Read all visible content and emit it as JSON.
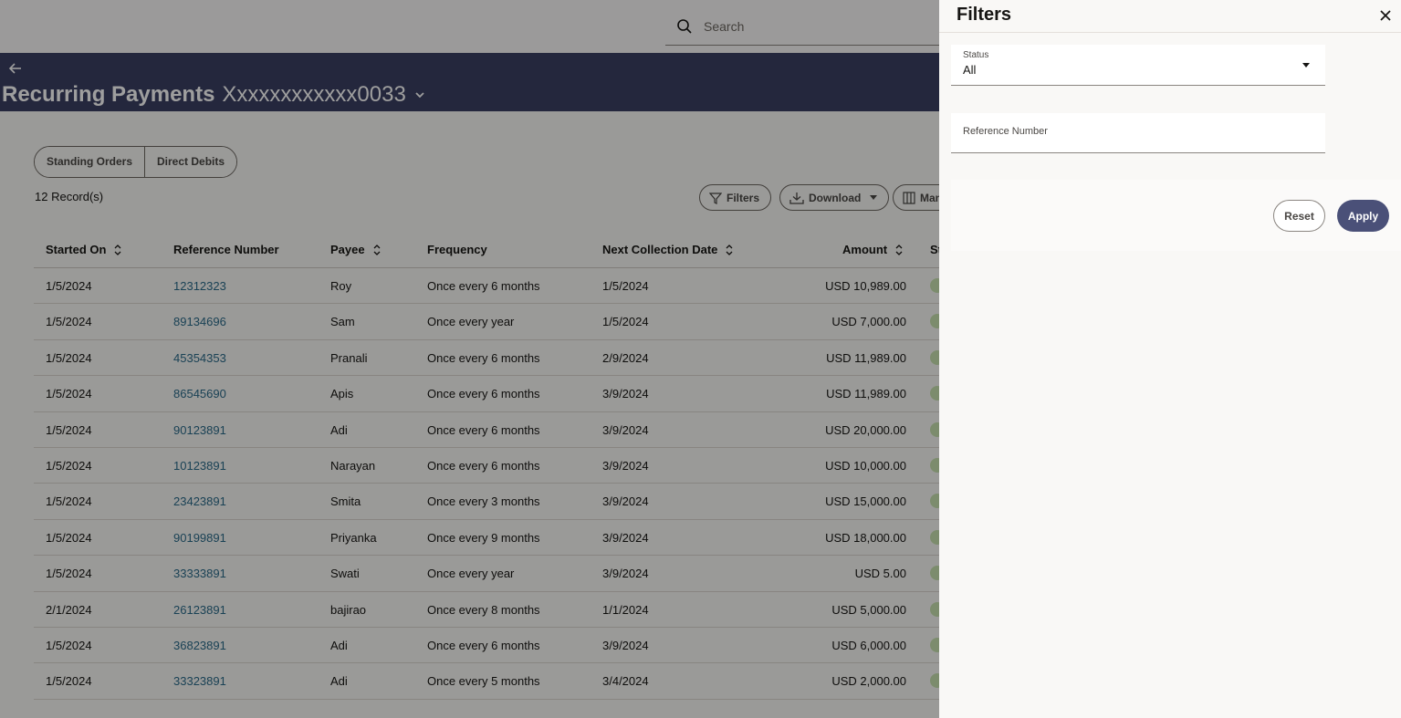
{
  "search": {
    "placeholder": "Search"
  },
  "hero": {
    "title": "Recurring Payments",
    "account": "Xxxxxxxxxxxx0033"
  },
  "tabs": [
    "Standing Orders",
    "Direct Debits"
  ],
  "records_label": "12 Record(s)",
  "toolbar": {
    "filters_label": "Filters",
    "download_label": "Download",
    "manage_label": "Man"
  },
  "table": {
    "headers": {
      "started_on": "Started On",
      "reference": "Reference Number",
      "payee": "Payee",
      "frequency": "Frequency",
      "next_collection": "Next Collection Date",
      "amount": "Amount",
      "status": "St"
    },
    "rows": [
      {
        "started_on": "1/5/2024",
        "reference": "12312323",
        "payee": "Roy",
        "frequency": "Once every 6 months",
        "next": "1/5/2024",
        "amount": "USD 10,989.00"
      },
      {
        "started_on": "1/5/2024",
        "reference": "89134696",
        "payee": "Sam",
        "frequency": "Once every year",
        "next": "1/5/2024",
        "amount": "USD 7,000.00"
      },
      {
        "started_on": "1/5/2024",
        "reference": "45354353",
        "payee": "Pranali",
        "frequency": "Once every 6 months",
        "next": "2/9/2024",
        "amount": "USD 11,989.00"
      },
      {
        "started_on": "1/5/2024",
        "reference": "86545690",
        "payee": "Apis",
        "frequency": "Once every 6 months",
        "next": "3/9/2024",
        "amount": "USD 11,989.00"
      },
      {
        "started_on": "1/5/2024",
        "reference": "90123891",
        "payee": "Adi",
        "frequency": "Once every 6 months",
        "next": "3/9/2024",
        "amount": "USD 20,000.00"
      },
      {
        "started_on": "1/5/2024",
        "reference": "10123891",
        "payee": "Narayan",
        "frequency": "Once every 6 months",
        "next": "3/9/2024",
        "amount": "USD 10,000.00"
      },
      {
        "started_on": "1/5/2024",
        "reference": "23423891",
        "payee": "Smita",
        "frequency": "Once every 3 months",
        "next": "3/9/2024",
        "amount": "USD 15,000.00"
      },
      {
        "started_on": "1/5/2024",
        "reference": "90199891",
        "payee": "Priyanka",
        "frequency": "Once every 9 months",
        "next": "3/9/2024",
        "amount": "USD 18,000.00"
      },
      {
        "started_on": "1/5/2024",
        "reference": "33333891",
        "payee": "Swati",
        "frequency": "Once every year",
        "next": "3/9/2024",
        "amount": "USD 5.00"
      },
      {
        "started_on": "2/1/2024",
        "reference": "26123891",
        "payee": "bajirao",
        "frequency": "Once every 8 months",
        "next": "1/1/2024",
        "amount": "USD 5,000.00"
      },
      {
        "started_on": "1/5/2024",
        "reference": "36823891",
        "payee": "Adi",
        "frequency": "Once every 6 months",
        "next": "3/9/2024",
        "amount": "USD 6,000.00"
      },
      {
        "started_on": "1/5/2024",
        "reference": "33323891",
        "payee": "Adi",
        "frequency": "Once every 5 months",
        "next": "3/4/2024",
        "amount": "USD 2,000.00"
      }
    ]
  },
  "filters": {
    "title": "Filters",
    "status_label": "Status",
    "status_value": "All",
    "reference_label": "Reference Number",
    "reset_label": "Reset",
    "apply_label": "Apply"
  },
  "colors": {
    "hero_bg": "#3a3f63",
    "link": "#2b6b8a",
    "apply_bg": "#4a5078",
    "status_dot": "#c9e3b0"
  },
  "icons": [
    "search-icon",
    "back-arrow-icon",
    "chevron-down-icon",
    "filter-icon",
    "download-icon",
    "columns-icon",
    "sort-icon",
    "close-icon"
  ]
}
